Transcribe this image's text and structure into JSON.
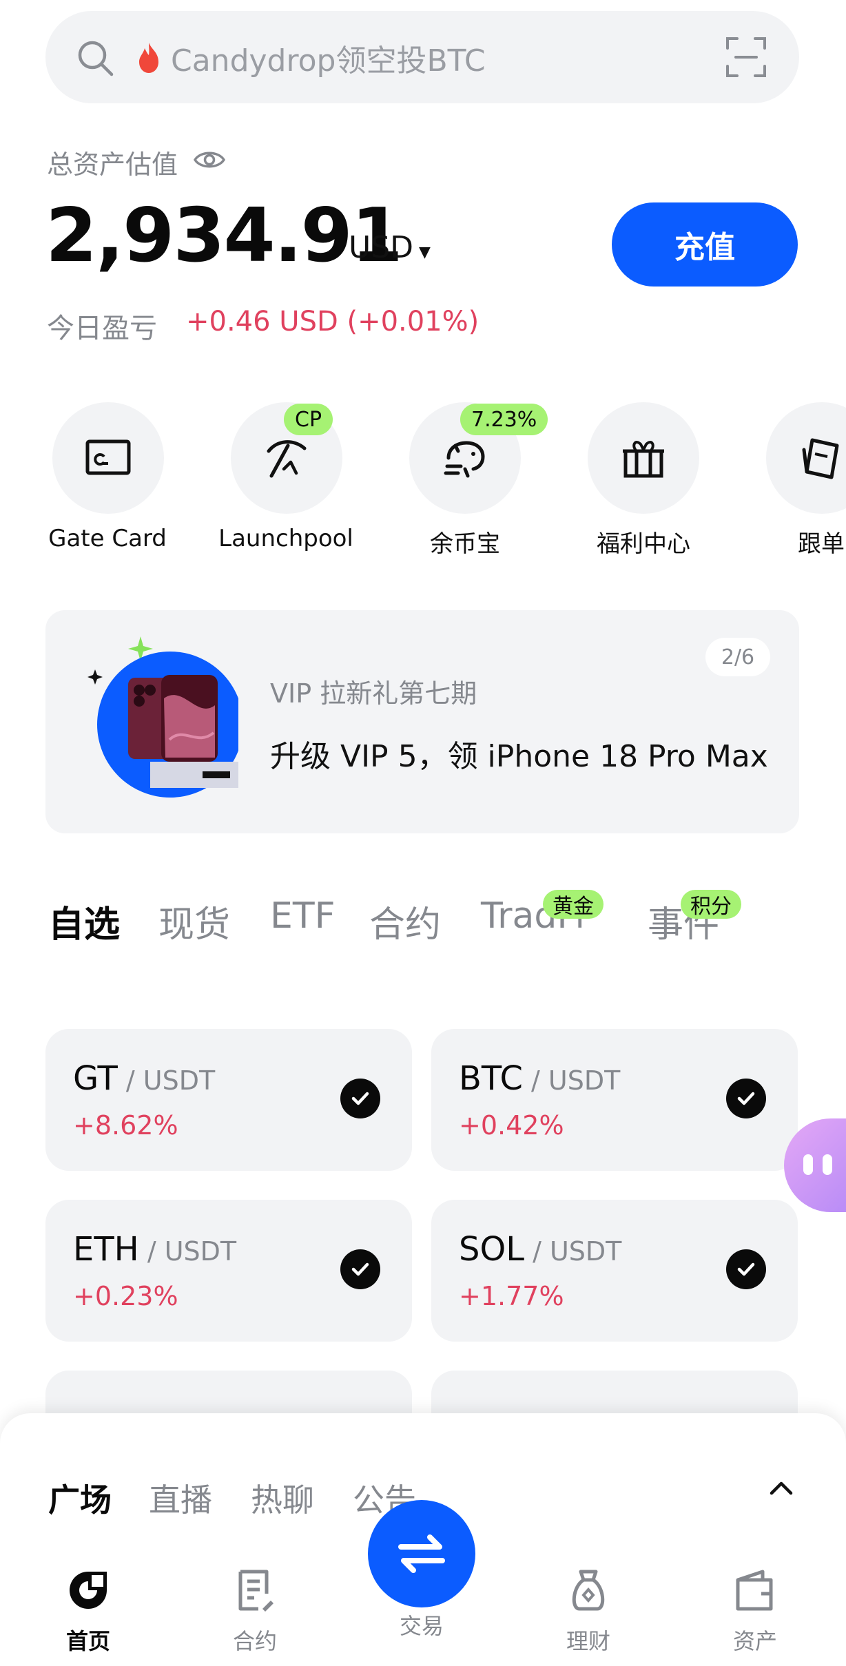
{
  "search": {
    "placeholder": "Candydrop领空投BTC",
    "icon": "search-icon",
    "scan_icon": "scan-icon"
  },
  "assets": {
    "label": "总资产估值",
    "amount": "2,934.91",
    "currency": "USD",
    "deposit_label": "充值",
    "pnl_label": "今日盈亏",
    "pnl_value": "+0.46 USD (+0.01%)"
  },
  "quick_actions": [
    {
      "label": "Gate Card",
      "icon": "card-icon",
      "badge": ""
    },
    {
      "label": "Launchpool",
      "icon": "pickaxe-icon",
      "badge": "CP"
    },
    {
      "label": "余币宝",
      "icon": "piggy-bank-icon",
      "badge": "7.23%"
    },
    {
      "label": "福利中心",
      "icon": "gift-icon",
      "badge": ""
    },
    {
      "label": "跟单",
      "icon": "copy-trade-icon",
      "badge": ""
    }
  ],
  "banner": {
    "pager": "2/6",
    "subtitle": "VIP 拉新礼第七期",
    "headline": "升级 VIP 5，领 iPhone 18 Pro Max"
  },
  "market_tabs": [
    {
      "label": "自选",
      "badge": ""
    },
    {
      "label": "现货",
      "badge": ""
    },
    {
      "label": "ETF",
      "badge": ""
    },
    {
      "label": "合约",
      "badge": ""
    },
    {
      "label": "TradFi",
      "badge": "黄金"
    },
    {
      "label": "事件",
      "badge": "积分"
    }
  ],
  "watchlist": [
    {
      "base": "GT",
      "quote": " / USDT",
      "change": "+8.62%"
    },
    {
      "base": "BTC",
      "quote": " / USDT",
      "change": "+0.42%"
    },
    {
      "base": "ETH",
      "quote": " / USDT",
      "change": "+0.23%"
    },
    {
      "base": "SOL",
      "quote": " / USDT",
      "change": "+1.77%"
    }
  ],
  "sheet_tabs": [
    "广场",
    "直播",
    "热聊",
    "公告"
  ],
  "bottom_nav": [
    {
      "label": "首页",
      "icon": "home-icon"
    },
    {
      "label": "合约",
      "icon": "contract-icon"
    },
    {
      "label": "交易",
      "icon": "swap-icon"
    },
    {
      "label": "理财",
      "icon": "wealth-icon"
    },
    {
      "label": "资产",
      "icon": "wallet-icon"
    }
  ],
  "colors": {
    "accent": "#0b5cff",
    "positive": "#e0415e",
    "badge": "#a6f273"
  }
}
